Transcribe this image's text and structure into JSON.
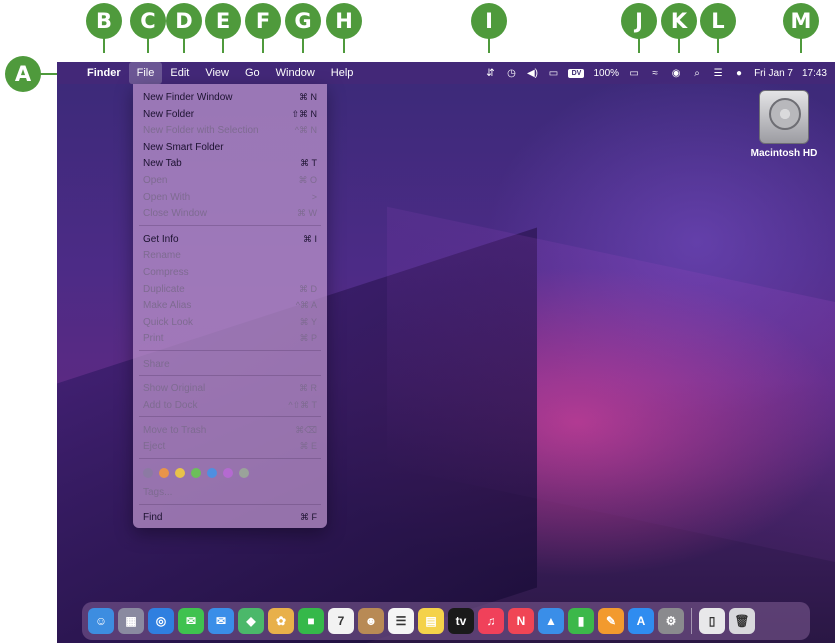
{
  "callouts": [
    "A",
    "B",
    "C",
    "D",
    "E",
    "F",
    "G",
    "H",
    "I",
    "J",
    "K",
    "L",
    "M"
  ],
  "menubar": {
    "apple_glyph": "",
    "items": [
      "Finder",
      "File",
      "Edit",
      "View",
      "Go",
      "Window",
      "Help"
    ],
    "battery": "100%",
    "date": "Fri Jan 7",
    "time": "17:43",
    "status_badge": "DV"
  },
  "file_menu": {
    "items": [
      {
        "label": "New Finder Window",
        "shortcut": "⌘ N"
      },
      {
        "label": "New Folder",
        "shortcut": "⇧⌘ N"
      },
      {
        "label": "New Folder with Selection",
        "shortcut": "^⌘ N"
      },
      {
        "label": "New Smart Folder",
        "shortcut": ""
      },
      {
        "label": "New Tab",
        "shortcut": "⌘ T"
      },
      {
        "label": "Open",
        "shortcut": "⌘ O"
      },
      {
        "label": "Open With",
        "shortcut": ">"
      },
      {
        "label": "Close Window",
        "shortcut": "⌘ W"
      },
      {
        "label": "Get Info",
        "shortcut": "⌘ I"
      },
      {
        "label": "Rename",
        "shortcut": ""
      },
      {
        "label": "Compress",
        "shortcut": ""
      },
      {
        "label": "Duplicate",
        "shortcut": "⌘ D"
      },
      {
        "label": "Make Alias",
        "shortcut": "^⌘ A"
      },
      {
        "label": "Quick Look",
        "shortcut": "⌘ Y"
      },
      {
        "label": "Print",
        "shortcut": "⌘ P"
      },
      {
        "label": "Share",
        "shortcut": ""
      },
      {
        "label": "Show Original",
        "shortcut": "⌘ R"
      },
      {
        "label": "Add to Dock",
        "shortcut": "^⇧⌘ T"
      },
      {
        "label": "Move to Trash",
        "shortcut": "⌘⌫"
      },
      {
        "label": "Eject",
        "shortcut": "⌘ E"
      },
      {
        "label": "Tags...",
        "shortcut": ""
      },
      {
        "label": "Find",
        "shortcut": "⌘ F"
      }
    ],
    "tag_colors": [
      "#8c7aa3",
      "#e8944a",
      "#e8c24a",
      "#6cbf5a",
      "#4f8fe0",
      "#b46ad0",
      "#9aa39a"
    ]
  },
  "desktop": {
    "drive_label": "Macintosh HD"
  },
  "dock": {
    "apps": [
      {
        "name": "finder-app",
        "glyph": "☺",
        "color": "#3d8de0"
      },
      {
        "name": "launchpad-app",
        "glyph": "▦",
        "color": "#8a8aa0"
      },
      {
        "name": "safari-app",
        "glyph": "◎",
        "color": "#2f7fe0"
      },
      {
        "name": "messages-app",
        "glyph": "✉",
        "color": "#3fc24f"
      },
      {
        "name": "mail-app",
        "glyph": "✉",
        "color": "#3a8ee8"
      },
      {
        "name": "maps-app",
        "glyph": "◆",
        "color": "#4bb86a"
      },
      {
        "name": "photos-app",
        "glyph": "✿",
        "color": "#e8b04a"
      },
      {
        "name": "facetime-app",
        "glyph": "■",
        "color": "#35b84a"
      },
      {
        "name": "calendar-app",
        "glyph": "7",
        "color": "#f2f2f2"
      },
      {
        "name": "contacts-app",
        "glyph": "☻",
        "color": "#b88a55"
      },
      {
        "name": "reminders-app",
        "glyph": "☰",
        "color": "#f5f5f5"
      },
      {
        "name": "notes-app",
        "glyph": "▤",
        "color": "#f4d24a"
      },
      {
        "name": "tv-app",
        "glyph": "tv",
        "color": "#1a1a1a"
      },
      {
        "name": "music-app",
        "glyph": "♫",
        "color": "#f0415a"
      },
      {
        "name": "news-app",
        "glyph": "N",
        "color": "#f04555"
      },
      {
        "name": "keynote-app",
        "glyph": "▲",
        "color": "#3a8ee8"
      },
      {
        "name": "numbers-app",
        "glyph": "▮",
        "color": "#3cb84a"
      },
      {
        "name": "pages-app",
        "glyph": "✎",
        "color": "#f29a2e"
      },
      {
        "name": "app-store-app",
        "glyph": "A",
        "color": "#2f8cf0"
      },
      {
        "name": "system-preferences-app",
        "glyph": "⚙",
        "color": "#8a8a8e"
      }
    ],
    "right": [
      {
        "name": "document-stack",
        "glyph": "▯",
        "color": "#e8e8ea"
      },
      {
        "name": "trash-app",
        "glyph": "🗑",
        "color": "#d8d8dc"
      }
    ]
  }
}
